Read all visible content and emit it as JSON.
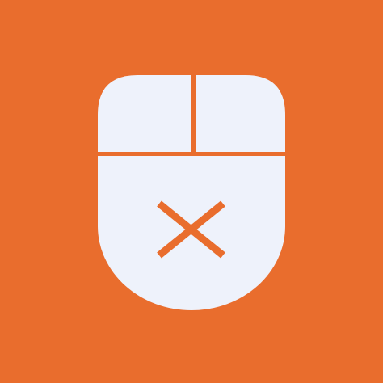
{
  "app_icon": {
    "icon": "mouse-x-icon",
    "colors": {
      "background": "#e96d2d",
      "mouse_body": "#eef2fb",
      "accent": "#e96d2d"
    }
  }
}
